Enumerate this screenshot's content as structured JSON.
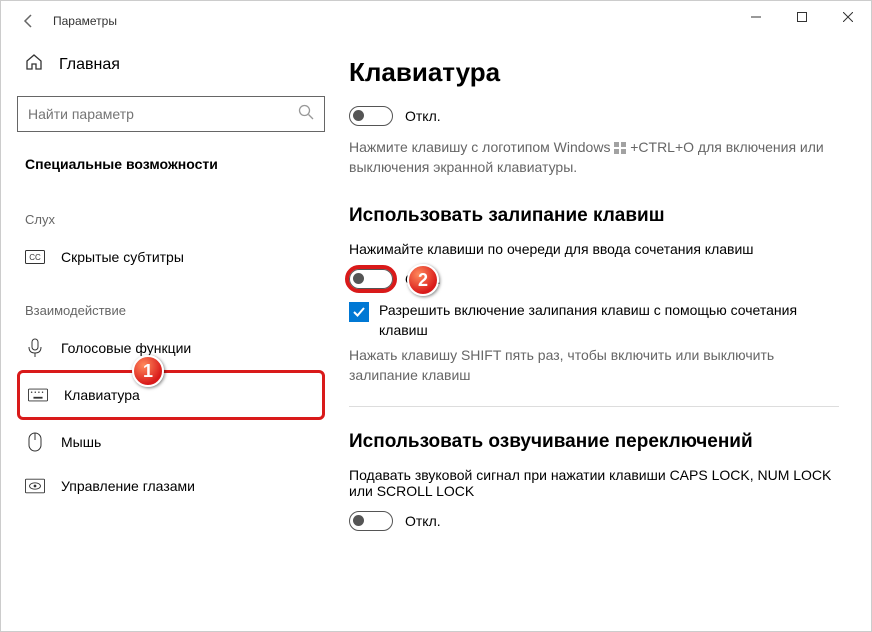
{
  "window": {
    "title": "Параметры"
  },
  "sidebar": {
    "home_label": "Главная",
    "search_placeholder": "Найти параметр",
    "main_section": "Специальные возможности",
    "groups": [
      {
        "label": "Слух",
        "items": [
          {
            "id": "subtitles",
            "label": "Скрытые субтитры",
            "icon": "cc"
          }
        ]
      },
      {
        "label": "Взаимодействие",
        "items": [
          {
            "id": "voice",
            "label": "Голосовые функции",
            "icon": "mic"
          },
          {
            "id": "keyboard",
            "label": "Клавиатура",
            "icon": "keyboard",
            "selected": true,
            "highlighted": true
          },
          {
            "id": "mouse",
            "label": "Мышь",
            "icon": "mouse"
          },
          {
            "id": "eye",
            "label": "Управление глазами",
            "icon": "eye"
          }
        ]
      }
    ]
  },
  "main": {
    "title": "Клавиатура",
    "toggle1": {
      "state": "Откл."
    },
    "help1_prefix": "Нажмите клавишу с логотипом Windows ",
    "help1_suffix": " +CTRL+O для включения или выключения экранной клавиатуры.",
    "section_sticky": {
      "title": "Использовать залипание клавиш",
      "desc": "Нажимайте клавиши по очереди для ввода сочетания клавиш",
      "toggle": {
        "state": "Откл."
      },
      "checkbox_label": "Разрешить включение залипания клавиш с помощью сочетания клавиш",
      "subhelp": "Нажать клавишу SHIFT пять раз, чтобы включить или выключить залипание клавиш"
    },
    "section_sound": {
      "title": "Использовать озвучивание переключений",
      "desc": "Подавать звуковой сигнал при нажатии клавиши CAPS LOCK, NUM LOCK или SCROLL LOCK",
      "toggle": {
        "state": "Откл."
      }
    }
  },
  "annotations": {
    "badge1": "1",
    "badge2": "2"
  }
}
